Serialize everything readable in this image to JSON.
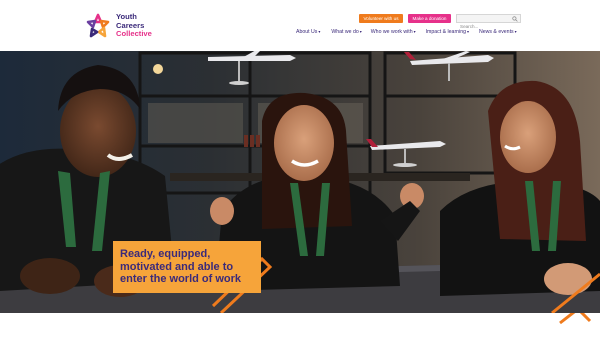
{
  "brand": {
    "name_line1": "Youth",
    "name_line2": "Careers",
    "name_line3": "Collective",
    "colors": {
      "navy": "#3b2a7a",
      "pink": "#e6318a",
      "orange": "#ef7b1d",
      "amber": "#f6a43a"
    }
  },
  "utility": {
    "volunteer_label": "Volunteer with us",
    "donate_label": "Make a donation",
    "search_placeholder": "Search..."
  },
  "nav": {
    "items": [
      {
        "label": "About Us"
      },
      {
        "label": "What we do"
      },
      {
        "label": "Who we work with"
      },
      {
        "label": "Impact & learning"
      },
      {
        "label": "News & events"
      }
    ],
    "caret": "▾"
  },
  "hero": {
    "tagline": "Ready, equipped, motivated and able to enter the world of work"
  },
  "icons": [
    "logo-star-icon",
    "search-icon",
    "chevron-down-icon"
  ]
}
